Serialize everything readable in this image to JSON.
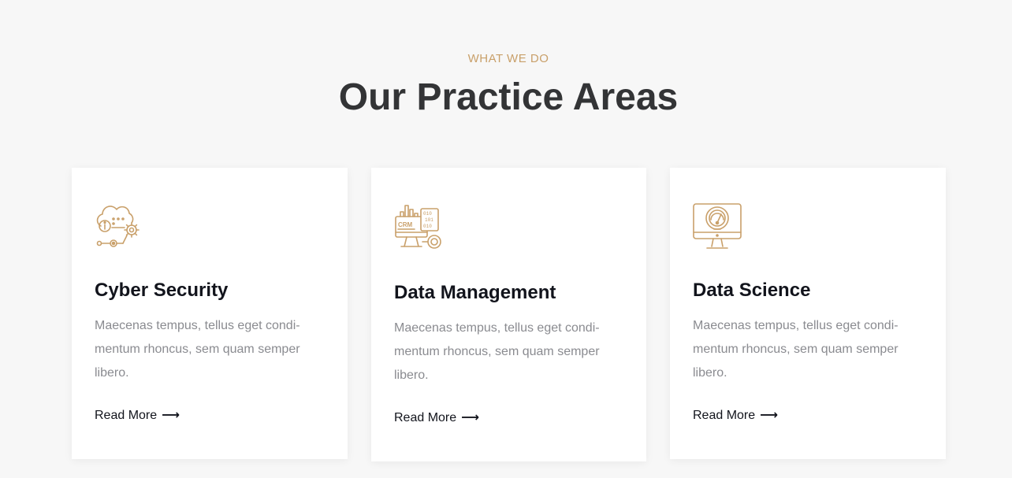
{
  "section": {
    "eyebrow": "WHAT WE DO",
    "title": "Our Practice Areas"
  },
  "cards": [
    {
      "icon": "cloud-gear-icon",
      "title": "Cyber Security",
      "text": "Maecenas tempus, tellus eget condi- mentum rhoncus, sem quam semper libero.",
      "link": "Read More"
    },
    {
      "icon": "crm-monitor-icon",
      "title": "Data Management",
      "text": "Maecenas tempus, tellus eget condi- mentum rhoncus, sem quam semper libero.",
      "link": "Read More"
    },
    {
      "icon": "monitor-gauge-icon",
      "title": "Data Science",
      "text": "Maecenas tempus, tellus eget condi- mentum rhoncus, sem quam semper libero.",
      "link": "Read More"
    }
  ],
  "colors": {
    "accent": "#c9a06a",
    "heading": "#333436",
    "card_title": "#12141c",
    "body_text": "#8a8b90",
    "background": "#f7f7f7"
  }
}
